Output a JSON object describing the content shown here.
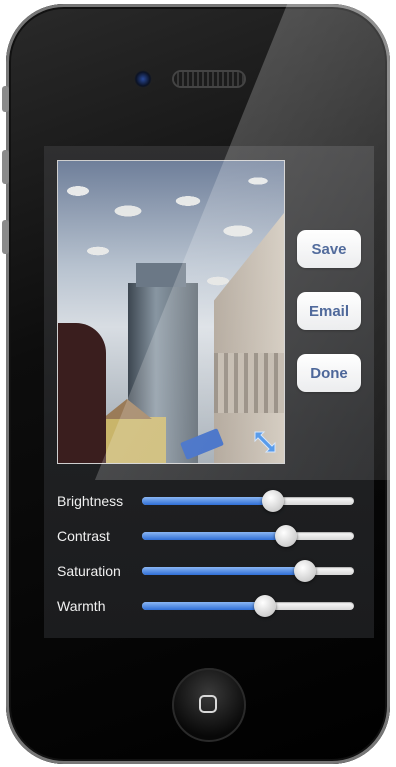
{
  "device": {
    "icons": {
      "camera": "camera-icon",
      "speaker": "speaker-icon",
      "home": "home-button-icon",
      "resize": "resize-arrows-icon"
    }
  },
  "actions": {
    "save_label": "Save",
    "email_label": "Email",
    "done_label": "Done"
  },
  "sliders": [
    {
      "label": "Brightness",
      "value": 0.62
    },
    {
      "label": "Contrast",
      "value": 0.68
    },
    {
      "label": "Saturation",
      "value": 0.77
    },
    {
      "label": "Warmth",
      "value": 0.58
    }
  ],
  "colors": {
    "accent": "#2f6fd6",
    "button_text": "#32508a"
  }
}
